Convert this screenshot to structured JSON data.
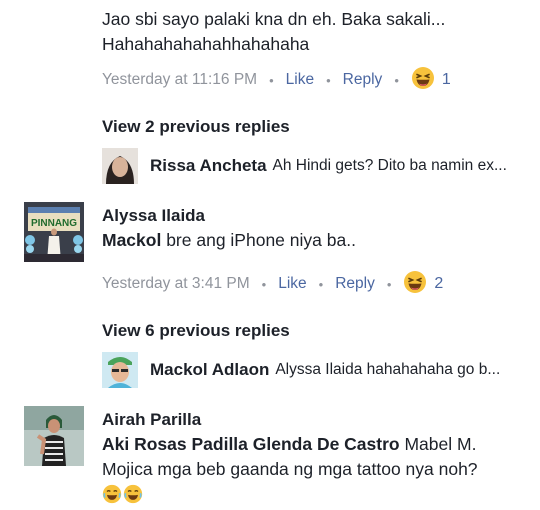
{
  "comment0": {
    "text_line1": "Jao sbi sayo palaki kna dn eh. Baka sakali...",
    "text_line2": "Hahahahahahahhahahaha",
    "time": "Yesterday at 11:16 PM",
    "like": "Like",
    "reply": "Reply",
    "reaction_count": "1"
  },
  "thread1": {
    "view_previous": "View 2 previous replies",
    "reply_name": "Rissa Ancheta",
    "reply_text": "Ah Hindi gets? Dito ba namin ex..."
  },
  "comment1": {
    "author": "Alyssa Ilaida",
    "tag": "Mackol",
    "text": "bre ang iPhone niya ba..",
    "time": "Yesterday at 3:41 PM",
    "like": "Like",
    "reply": "Reply",
    "reaction_count": "2",
    "avatar_banner_text": "PINNANG"
  },
  "thread2": {
    "view_previous": "View 6 previous replies",
    "reply_name": "Mackol Adlaon",
    "reply_text": "Alyssa Ilaida hahahahaha go b..."
  },
  "comment2": {
    "author": "Airah Parilla",
    "tags": "Aki Rosas Padilla Glenda De Castro",
    "text_after_tags": "Mabel M.",
    "text_line2": "Mojica mga beb gaanda ng mga tattoo nya noh?"
  },
  "colors": {
    "link": "#4b67a1",
    "meta_gray": "#90949c",
    "text": "#1d2129",
    "haha_yellow": "#f7c23c"
  }
}
